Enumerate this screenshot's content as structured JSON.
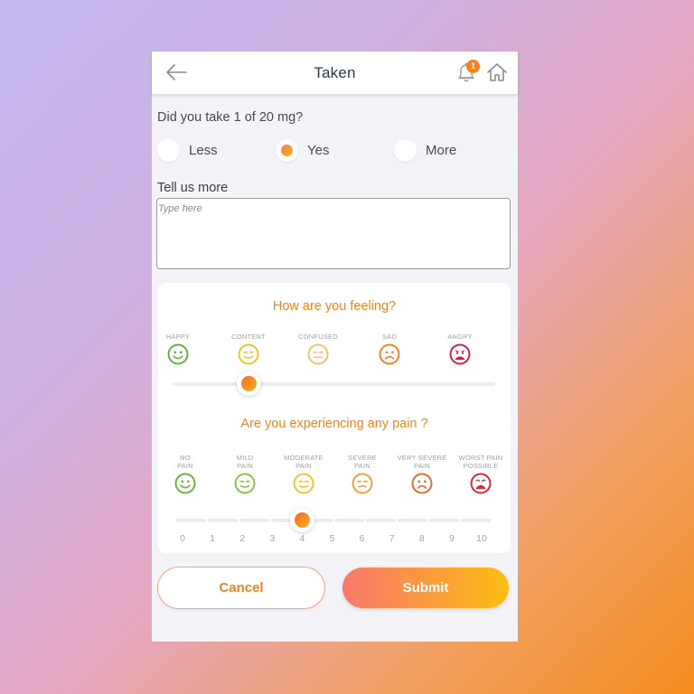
{
  "header": {
    "title": "Taken",
    "back_icon": "arrow-left-icon",
    "notification_icon": "bell-icon",
    "notification_count": "1",
    "home_icon": "home-icon"
  },
  "dose": {
    "question": "Did you take 1 of 20 mg?",
    "options": [
      {
        "label": "Less",
        "checked": false
      },
      {
        "label": "Yes",
        "checked": true
      },
      {
        "label": "More",
        "checked": false
      }
    ]
  },
  "notes": {
    "label": "Tell us more",
    "value": "",
    "placeholder": "Type here"
  },
  "mood": {
    "title": "How are you feeling?",
    "options": [
      {
        "label": "HAPPY",
        "icon": "happy-face-icon",
        "color": "#5fb045"
      },
      {
        "label": "CONTENT",
        "icon": "content-face-icon",
        "color": "#f2c32b"
      },
      {
        "label": "CONFUSED",
        "icon": "confused-face-icon",
        "color": "#f8c06a"
      },
      {
        "label": "SAD",
        "icon": "sad-face-icon",
        "color": "#f58220"
      },
      {
        "label": "ANGRY",
        "icon": "angry-face-icon",
        "color": "#d71f37"
      }
    ],
    "selected_index": 1,
    "selected_label": "CONTENT"
  },
  "pain": {
    "title": "Are you experiencing any pain ?",
    "options": [
      {
        "label_line1": "NO",
        "label_line2": "PAIN",
        "icon": "no-pain-face-icon",
        "color": "#65b544"
      },
      {
        "label_line1": "MILD",
        "label_line2": "PAIN",
        "icon": "mild-pain-face-icon",
        "color": "#8cc04a"
      },
      {
        "label_line1": "MODERATE",
        "label_line2": "PAIN",
        "icon": "moderate-pain-face-icon",
        "color": "#f2c32b"
      },
      {
        "label_line1": "SEVERE",
        "label_line2": "PAIN",
        "icon": "severe-pain-face-icon",
        "color": "#eea043"
      },
      {
        "label_line1": "VERY SEVERE",
        "label_line2": "PAIN",
        "icon": "very-severe-pain-face-icon",
        "color": "#e56a30"
      },
      {
        "label_line1": "WORST PAIN",
        "label_line2": "POSSIBLE",
        "icon": "worst-pain-face-icon",
        "color": "#d72a38"
      }
    ],
    "scale": [
      "0",
      "1",
      "2",
      "3",
      "4",
      "5",
      "6",
      "7",
      "8",
      "9",
      "10"
    ],
    "value": 4
  },
  "actions": {
    "cancel_label": "Cancel",
    "submit_label": "Submit"
  },
  "colors": {
    "accent": "#f58220",
    "title_text": "#1f3a50",
    "gradient_start": "#f8786c",
    "gradient_end": "#fcbe12"
  }
}
